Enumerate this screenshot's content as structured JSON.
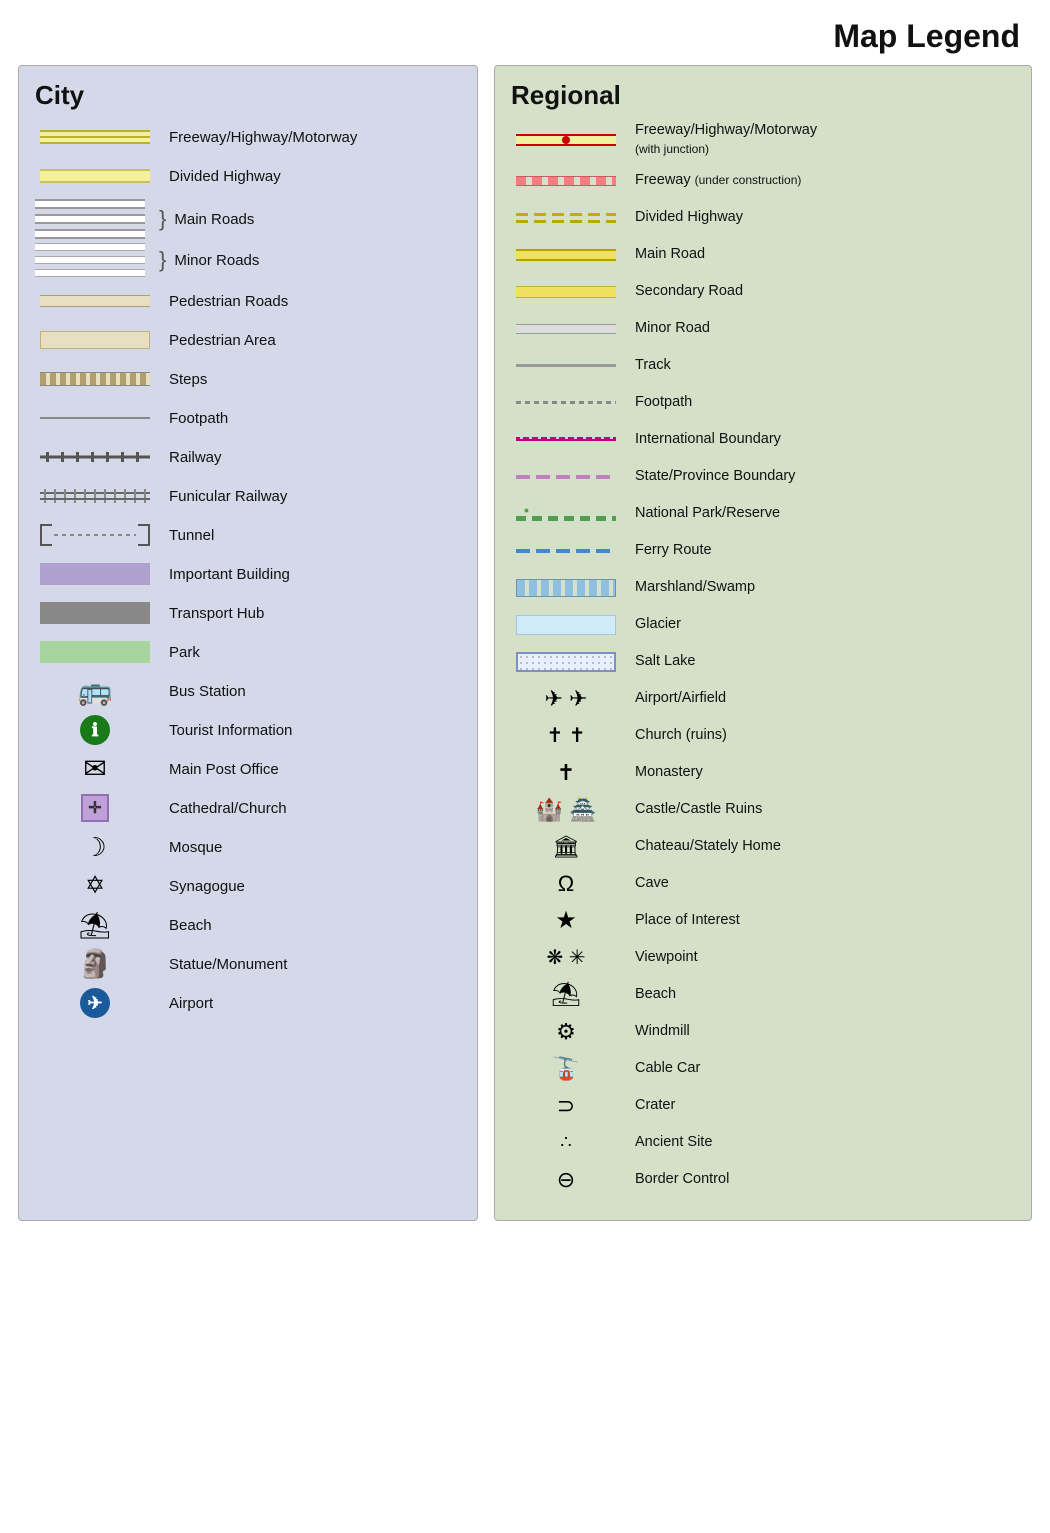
{
  "title": "Map Legend",
  "city": {
    "title": "City",
    "items": [
      {
        "id": "freeway",
        "label": "Freeway/Highway/Motorway"
      },
      {
        "id": "divided-highway",
        "label": "Divided Highway"
      },
      {
        "id": "main-roads",
        "label": "Main Roads"
      },
      {
        "id": "minor-roads",
        "label": "Minor Roads"
      },
      {
        "id": "pedestrian-roads",
        "label": "Pedestrian Roads"
      },
      {
        "id": "pedestrian-area",
        "label": "Pedestrian Area"
      },
      {
        "id": "steps",
        "label": "Steps"
      },
      {
        "id": "footpath",
        "label": "Footpath"
      },
      {
        "id": "railway",
        "label": "Railway"
      },
      {
        "id": "funicular",
        "label": "Funicular Railway"
      },
      {
        "id": "tunnel",
        "label": "Tunnel"
      },
      {
        "id": "important-building",
        "label": "Important Building"
      },
      {
        "id": "transport-hub",
        "label": "Transport Hub"
      },
      {
        "id": "park",
        "label": "Park"
      },
      {
        "id": "bus-station",
        "label": "Bus Station"
      },
      {
        "id": "tourist-info",
        "label": "Tourist Information"
      },
      {
        "id": "post-office",
        "label": "Main Post Office"
      },
      {
        "id": "cathedral",
        "label": "Cathedral/Church"
      },
      {
        "id": "mosque",
        "label": "Mosque"
      },
      {
        "id": "synagogue",
        "label": "Synagogue"
      },
      {
        "id": "beach",
        "label": "Beach"
      },
      {
        "id": "statue",
        "label": "Statue/Monument"
      },
      {
        "id": "airport",
        "label": "Airport"
      }
    ]
  },
  "regional": {
    "title": "Regional",
    "items": [
      {
        "id": "reg-freeway",
        "label": "Freeway/Highway/Motorway",
        "sublabel": "(with junction)"
      },
      {
        "id": "reg-freeway-construction",
        "label": "Freeway",
        "sublabel": "(under construction)"
      },
      {
        "id": "reg-divided",
        "label": "Divided Highway"
      },
      {
        "id": "reg-main-road",
        "label": "Main Road"
      },
      {
        "id": "reg-secondary",
        "label": "Secondary Road"
      },
      {
        "id": "reg-minor",
        "label": "Minor Road"
      },
      {
        "id": "reg-track",
        "label": "Track"
      },
      {
        "id": "reg-footpath",
        "label": "Footpath"
      },
      {
        "id": "reg-intl-boundary",
        "label": "International Boundary"
      },
      {
        "id": "reg-state-boundary",
        "label": "State/Province Boundary"
      },
      {
        "id": "reg-nat-park",
        "label": "National Park/Reserve"
      },
      {
        "id": "reg-ferry",
        "label": "Ferry Route"
      },
      {
        "id": "reg-marshland",
        "label": "Marshland/Swamp"
      },
      {
        "id": "reg-glacier",
        "label": "Glacier"
      },
      {
        "id": "reg-salt-lake",
        "label": "Salt Lake"
      },
      {
        "id": "reg-airport",
        "label": "Airport/Airfield"
      },
      {
        "id": "reg-church",
        "label": "Church (ruins)"
      },
      {
        "id": "reg-monastery",
        "label": "Monastery"
      },
      {
        "id": "reg-castle",
        "label": "Castle/Castle Ruins"
      },
      {
        "id": "reg-chateau",
        "label": "Chateau/Stately Home"
      },
      {
        "id": "reg-cave",
        "label": "Cave"
      },
      {
        "id": "reg-place-interest",
        "label": "Place of Interest"
      },
      {
        "id": "reg-viewpoint",
        "label": "Viewpoint"
      },
      {
        "id": "reg-beach",
        "label": "Beach"
      },
      {
        "id": "reg-windmill",
        "label": "Windmill"
      },
      {
        "id": "reg-cable-car",
        "label": "Cable Car"
      },
      {
        "id": "reg-crater",
        "label": "Crater"
      },
      {
        "id": "reg-ancient-site",
        "label": "Ancient Site"
      },
      {
        "id": "reg-border-control",
        "label": "Border Control"
      }
    ]
  }
}
